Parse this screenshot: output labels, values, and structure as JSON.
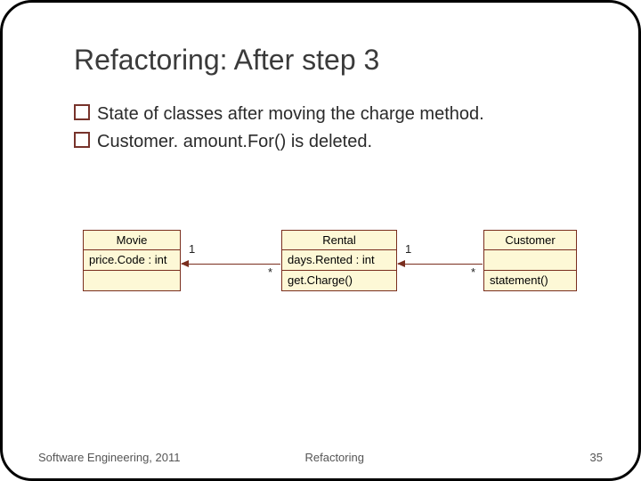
{
  "title": "Refactoring: After step 3",
  "bullets": [
    "State of classes after moving the charge method.",
    " Customer. amount.For() is deleted."
  ],
  "classes": {
    "movie": {
      "name": "Movie",
      "attrs": "price.Code : int",
      "ops": ""
    },
    "rental": {
      "name": "Rental",
      "attrs": "days.Rented : int",
      "ops": "get.Charge()"
    },
    "customer": {
      "name": "Customer",
      "attrs": "",
      "ops": "statement()"
    }
  },
  "multiplicities": {
    "movie_rental_left": "1",
    "movie_rental_right": "*",
    "rental_customer_left": "1",
    "rental_customer_right": "*"
  },
  "footer": {
    "left": "Software Engineering, 2011",
    "center": "Refactoring",
    "page": "35"
  }
}
